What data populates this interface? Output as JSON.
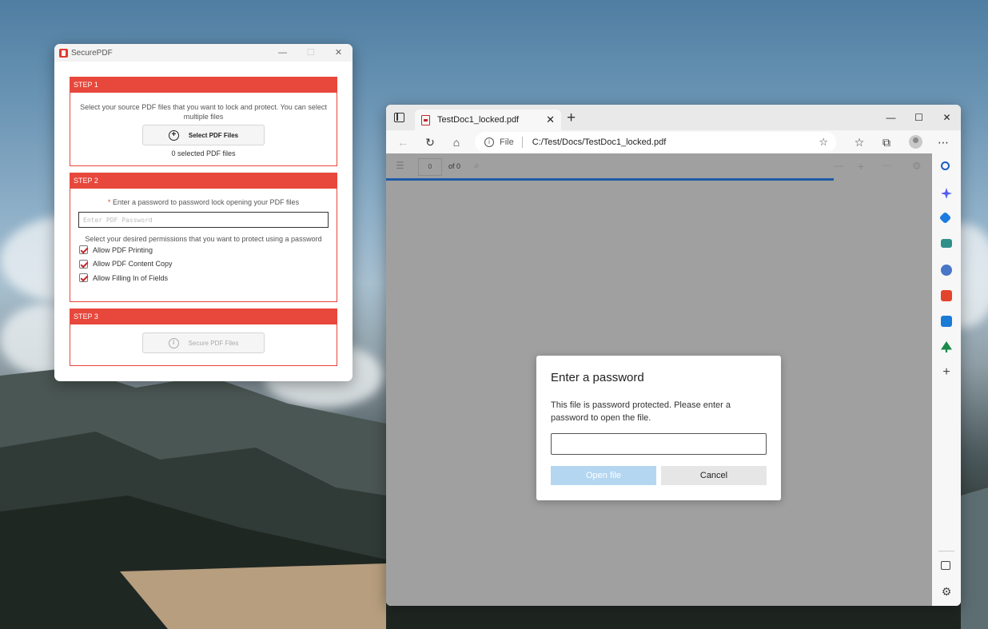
{
  "securepdf": {
    "title": "SecurePDF",
    "window_controls": {
      "minimize": "—",
      "maximize": "☐",
      "close": "✕"
    },
    "step1": {
      "header": "STEP 1",
      "description": "Select your source PDF files that you want to lock and protect. You can select multiple files",
      "button_label": "Select PDF Files",
      "selected_count": "0 selected PDF files"
    },
    "step2": {
      "header": "STEP 2",
      "required_mark": "*",
      "password_prompt": "Enter a password to password lock opening your PDF files",
      "password_placeholder": "Enter PDF Password",
      "permissions_prompt": "Select your desired permissions that you want to protect using a password",
      "permissions": [
        {
          "label": "Allow PDF Printing",
          "checked": true
        },
        {
          "label": "Allow PDF Content Copy",
          "checked": true
        },
        {
          "label": "Allow Filling In of Fields",
          "checked": true
        }
      ]
    },
    "step3": {
      "header": "STEP 3",
      "button_label": "Secure PDF Files"
    },
    "accent_color": "#e8473b"
  },
  "browser": {
    "tab": {
      "title": "TestDoc1_locked.pdf",
      "close": "✕"
    },
    "new_tab": "+",
    "window_controls": {
      "minimize": "—",
      "maximize": "☐",
      "close": "✕"
    },
    "address": {
      "scheme": "File",
      "url": "C:/Test/Docs/TestDoc1_locked.pdf"
    },
    "pdf_toolbar": {
      "page_number": "0",
      "of_pages": "of 0"
    },
    "dialog": {
      "title": "Enter a password",
      "message": "This file is password protected. Please enter a password to open the file.",
      "open_label": "Open file",
      "cancel_label": "Cancel"
    },
    "sidebar_icons": [
      "search-icon",
      "copilot-icon",
      "shopping-icon",
      "tools-icon",
      "games-icon",
      "office-icon",
      "outlook-icon",
      "tree-icon",
      "add-icon",
      "split-screen-icon",
      "settings-icon"
    ],
    "progress_color": "#1f5aa6"
  }
}
